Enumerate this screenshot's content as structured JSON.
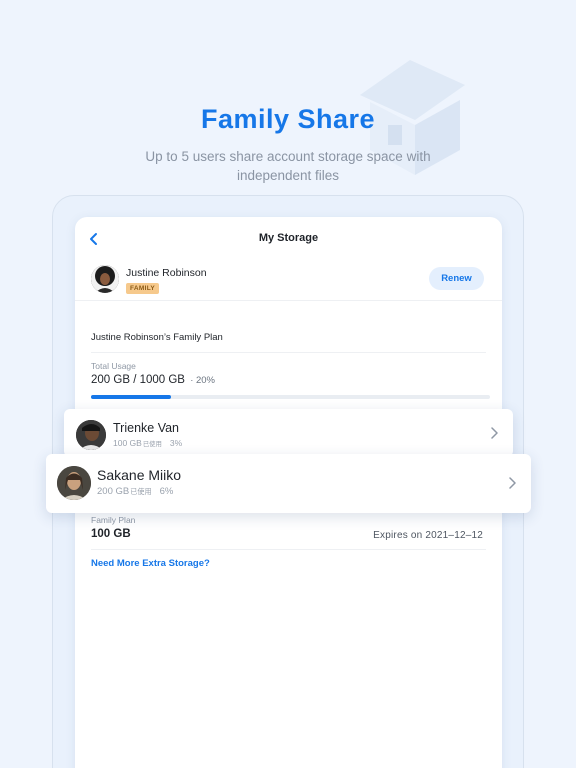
{
  "hero": {
    "title": "Family Share",
    "subtitle": "Up to 5 users share account storage space with independent files"
  },
  "nav": {
    "title": "My Storage",
    "back_icon": "chevron-left-icon"
  },
  "owner": {
    "name": "Justine Robinson",
    "badge": "FAMILY",
    "renew_label": "Renew"
  },
  "plan": {
    "name": "Justine Robinson’s Family Plan",
    "total_label": "Total Usage",
    "total_value": "200 GB / 1000 GB",
    "total_percent": "· 20%",
    "progress_fraction": 0.2
  },
  "members": [
    {
      "name": "Trienke Van",
      "storage": "100 GB",
      "used_label": "已使用",
      "percent": "3%"
    },
    {
      "name": "Sakane Miiko",
      "storage": "200 GB",
      "used_label": "已使用",
      "percent": "6%"
    }
  ],
  "family_plan": {
    "label": "Family Plan",
    "size": "100 GB",
    "expiry": "Expires on 2021–12–12"
  },
  "extra_storage_link": "Need More Extra Storage?",
  "colors": {
    "accent": "#1677e8",
    "background": "#eef4fd",
    "badge": "#f6c98c"
  }
}
